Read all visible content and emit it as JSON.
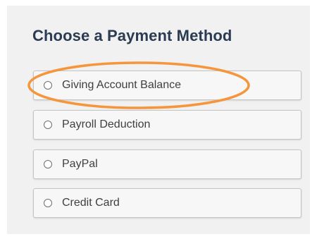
{
  "page": {
    "title": "Choose a Payment Method"
  },
  "options": [
    {
      "label": "Giving Account Balance"
    },
    {
      "label": "Payroll Deduction"
    },
    {
      "label": "PayPal"
    },
    {
      "label": "Credit Card"
    }
  ],
  "colors": {
    "highlight": "#f5963c",
    "title": "#2b3b52",
    "panel": "#f1f1f1"
  }
}
